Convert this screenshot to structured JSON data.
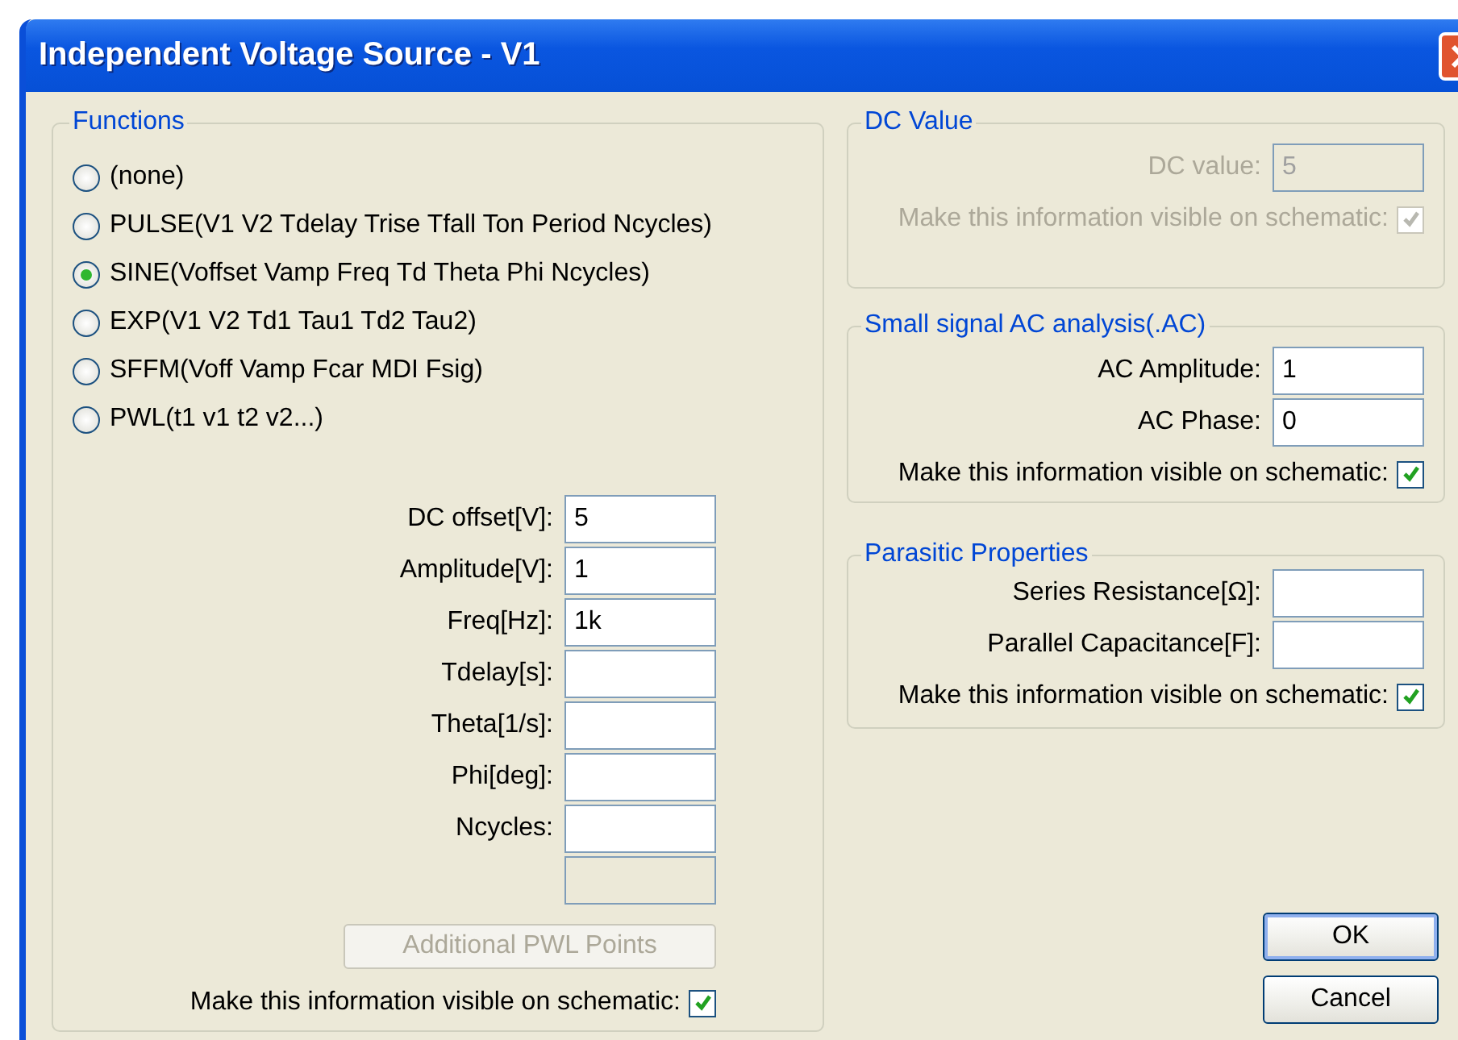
{
  "window": {
    "title": "Independent Voltage Source - V1"
  },
  "functions": {
    "title": "Functions",
    "options": [
      {
        "label": "(none)",
        "selected": false
      },
      {
        "label": "PULSE(V1 V2 Tdelay Trise Tfall Ton Period Ncycles)",
        "selected": false
      },
      {
        "label": "SINE(Voffset Vamp Freq Td Theta Phi Ncycles)",
        "selected": true
      },
      {
        "label": "EXP(V1 V2 Td1 Tau1 Td2 Tau2)",
        "selected": false
      },
      {
        "label": "SFFM(Voff Vamp Fcar MDI Fsig)",
        "selected": false
      },
      {
        "label": "PWL(t1 v1 t2 v2...)",
        "selected": false
      }
    ],
    "fields": [
      {
        "label": "DC offset[V]:",
        "value": "5"
      },
      {
        "label": "Amplitude[V]:",
        "value": "1"
      },
      {
        "label": "Freq[Hz]:",
        "value": "1k"
      },
      {
        "label": "Tdelay[s]:"
      },
      {
        "label": "Theta[1/s]:"
      },
      {
        "label": "Phi[deg]:"
      },
      {
        "label": "Ncycles:"
      }
    ],
    "blank_field": {
      "disabled": true
    },
    "pwl_button": {
      "label": "Additional PWL Points",
      "disabled": true
    },
    "visible": {
      "label": "Make this information visible on schematic:",
      "checked": true
    }
  },
  "dc_value": {
    "title": "DC Value",
    "disabled": true,
    "fields": [
      {
        "label": "DC value:",
        "value": "5"
      }
    ],
    "visible": {
      "label": "Make this information visible on schematic:",
      "checked": true
    }
  },
  "ac_analysis": {
    "title": "Small signal AC analysis(.AC)",
    "disabled": false,
    "fields": [
      {
        "label": "AC Amplitude:",
        "value": "1"
      },
      {
        "label": "AC Phase:",
        "value": "0"
      }
    ],
    "visible": {
      "label": "Make this information visible on schematic:",
      "checked": true
    }
  },
  "parasitic": {
    "title": "Parasitic Properties",
    "disabled": false,
    "fields": [
      {
        "label": "Series Resistance[Ω]:"
      },
      {
        "label": "Parallel Capacitance[F]:"
      }
    ],
    "visible": {
      "label": "Make this information visible on schematic:",
      "checked": true
    }
  },
  "buttons": [
    {
      "label": "OK",
      "default": true
    },
    {
      "label": "Cancel",
      "default": false
    }
  ]
}
